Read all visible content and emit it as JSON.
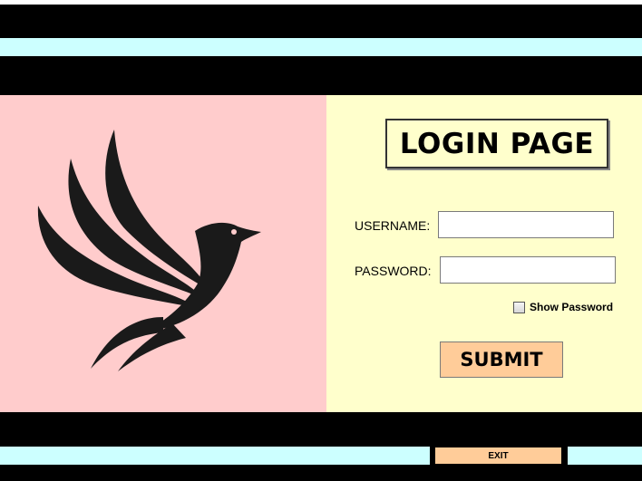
{
  "header": {
    "colors": {
      "black_band": "#000000",
      "cyan_band": "#ccffff"
    }
  },
  "left_panel": {
    "background": "#ffcccc",
    "logo_icon": "phoenix-bird-icon"
  },
  "login": {
    "title": "LOGIN PAGE",
    "username_label": "USERNAME:",
    "username_value": "",
    "password_label": "PASSWORD:",
    "password_value": "",
    "show_password_label": "Show Password",
    "show_password_checked": false,
    "submit_label": "SUBMIT",
    "background": "#ffffcc",
    "submit_color": "#ffcc99"
  },
  "footer": {
    "exit_label": "EXIT",
    "exit_color": "#ffcc99"
  }
}
